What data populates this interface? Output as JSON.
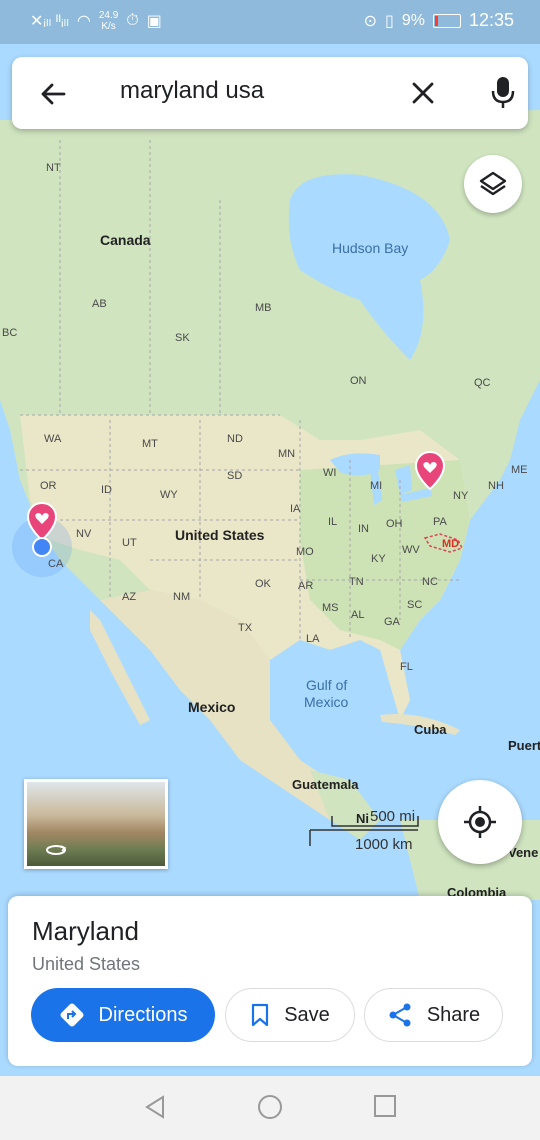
{
  "status_bar": {
    "net_speed": "24.9",
    "net_unit": "K/s",
    "battery": "9%",
    "time": "12:35"
  },
  "search": {
    "query": "maryland usa"
  },
  "map": {
    "labels": {
      "nt": "NT",
      "canada": "Canada",
      "hudson_bay": "Hudson Bay",
      "ab": "AB",
      "bc": "BC",
      "mb": "MB",
      "sk": "SK",
      "on": "ON",
      "qc": "QC",
      "wa": "WA",
      "mt": "MT",
      "nd": "ND",
      "mn": "MN",
      "me": "ME",
      "or": "OR",
      "id": "ID",
      "sd": "SD",
      "wi": "WI",
      "mi": "MI",
      "nh": "NH",
      "wy": "WY",
      "ny": "NY",
      "nv": "NV",
      "ut": "UT",
      "united_states": "United States",
      "ia": "IA",
      "il": "IL",
      "in": "IN",
      "oh": "OH",
      "pa": "PA",
      "md": "MD",
      "ca": "CA",
      "mo": "MO",
      "ky": "KY",
      "wv": "WV",
      "ok": "OK",
      "ar": "AR",
      "tn": "TN",
      "nc": "NC",
      "az": "AZ",
      "nm": "NM",
      "ms": "MS",
      "al": "AL",
      "sc": "SC",
      "tx": "TX",
      "ga": "GA",
      "la": "LA",
      "fl": "FL",
      "gulf": "Gulf of",
      "mexico_water": "Mexico",
      "mexico": "Mexico",
      "cuba": "Cuba",
      "puerto": "Puert",
      "guatemala": "Guatemala",
      "nicaragua": "Ni",
      "venezuela": "Vene",
      "colombia": "Colombia"
    }
  },
  "scale": {
    "miles": "500 mi",
    "km": "1000 km"
  },
  "place": {
    "name": "Maryland",
    "subtitle": "United States"
  },
  "actions": {
    "directions": "Directions",
    "save": "Save",
    "share": "Share"
  },
  "colors": {
    "accent": "#1a73e8",
    "pin": "#e8457a",
    "water": "#aadaff",
    "land": "#e9ecd3",
    "forest": "#b9d9a6"
  }
}
